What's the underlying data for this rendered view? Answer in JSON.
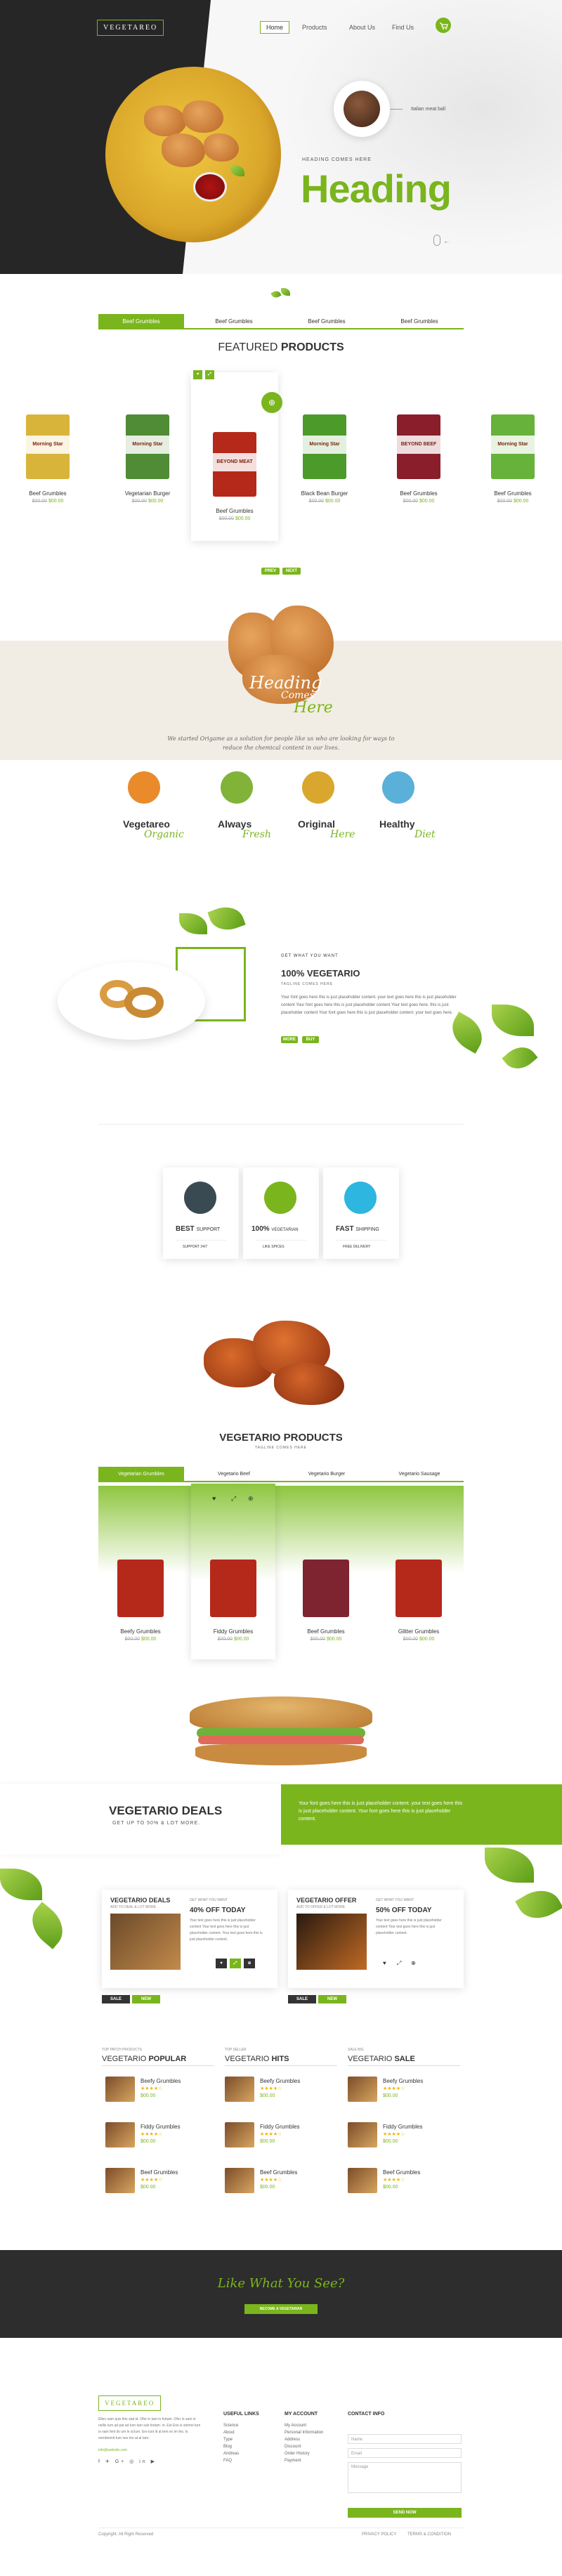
{
  "header": {
    "logo": "VEGETAREO",
    "nav": [
      "Home",
      "Products",
      "About Us",
      "Find Us"
    ]
  },
  "hero": {
    "bubble_label": "Italian meat ball",
    "kicker": "HEADING COMES HERE",
    "heading": "Heading"
  },
  "featured": {
    "tabs": [
      "Beef Grumbles",
      "Beef Grumbles",
      "Beef Grumbles",
      "Beef Grumbles"
    ],
    "title_a": "FEATURED",
    "title_b": "PRODUCTS",
    "products": [
      {
        "name": "Beef Grumbles",
        "old": "$00.00",
        "price": "$00.00",
        "brand": "Morning Star",
        "color": "#d9b43b"
      },
      {
        "name": "Vegetarian Burger",
        "old": "$00.00",
        "price": "$00.00",
        "brand": "Morning Star",
        "color": "#4f8c35"
      },
      {
        "name": "Beef Grumbles",
        "old": "$00.00",
        "price": "$00.00",
        "brand": "BEYOND MEAT",
        "color": "#b5291b"
      },
      {
        "name": "Black Bean Burger",
        "old": "$00.00",
        "price": "$00.00",
        "brand": "Morning Star",
        "color": "#4c9a2a"
      },
      {
        "name": "Beef Grumbles",
        "old": "$00.00",
        "price": "$00.00",
        "brand": "BEYOND BEEF",
        "color": "#8a1e2b"
      },
      {
        "name": "Beef Grumbles",
        "old": "$00.00",
        "price": "$00.00",
        "brand": "Morning Star",
        "color": "#66b23a"
      }
    ],
    "more_buttons": [
      "PREV",
      "NEXT"
    ]
  },
  "intro": {
    "script_a": "Heading",
    "script_b": "Comes",
    "script_c": "Here",
    "body": "We started Origame as a solution for people like us who are looking for ways to reduce the chemical content in our lives.",
    "features": [
      {
        "bold": "Vegetareo",
        "script": "Organic",
        "color": "#e98a2b"
      },
      {
        "bold": "Always",
        "script": "Fresh",
        "color": "#80b338"
      },
      {
        "bold": "Original",
        "script": "Here",
        "color": "#d9a72e"
      },
      {
        "bold": "Healthy",
        "script": "Diet",
        "color": "#5ab0d8"
      }
    ]
  },
  "about": {
    "kicker": "GET WHAT YOU WANT",
    "title": "100% VEGETARIO",
    "sub": "TAGLINE COMES HERE",
    "body": "Your font goes here this is just placeholder content. your text goes here this is just placeholder content Your font goes here this is just placeholder content Your text goes here. this is just placeholder content Your font goes here this is just placeholder content. your text goes here.",
    "btns": [
      "MORE",
      "BUY"
    ]
  },
  "services": [
    {
      "bold": "BEST",
      "rest": "SUPPORT",
      "foot": "SUPPORT 24/7",
      "color": "#3a4a52"
    },
    {
      "bold": "100%",
      "rest": "VEGETARIAN",
      "foot": "LIKE SPICES",
      "color": "#7ab51d"
    },
    {
      "bold": "FAST",
      "rest": "SHIPPING",
      "foot": "FREE DELIVERY",
      "color": "#2cb6e0"
    }
  ],
  "vegprod": {
    "title": "VEGETARIO PRODUCTS",
    "sub": "TAGLINE COMES HERE",
    "tabs": [
      "Vegetarian Grumbles",
      "Vegetario Beef",
      "Vegetario Burger",
      "Vegetario Sausage"
    ],
    "products": [
      {
        "name": "Beefy Grumbles",
        "old": "$00.00",
        "price": "$00.00",
        "color": "#b5291b"
      },
      {
        "name": "Fiddy Grumbles",
        "old": "$00.00",
        "price": "$00.00",
        "color": "#b5291b"
      },
      {
        "name": "Beef Grumbles",
        "old": "$00.00",
        "price": "$00.00",
        "color": "#7e2431"
      },
      {
        "name": "Glitter Grumbles",
        "old": "$00.00",
        "price": "$00.00",
        "color": "#b5291b"
      }
    ]
  },
  "deals": {
    "title": "VEGETARIO DEALS",
    "sub": "GET UP TO 50% & LOT MORE.",
    "text": "Your font goes here this is just placeholder content. your text goes here this is just placeholder content. Your font goes here this is just placeholder content.",
    "cards": [
      {
        "title": "VEGETARIO DEALS",
        "sub": "ADD TO DEAL & LOT MORE",
        "kicker": "GET WHAT YOU WANT",
        "off": "40% OFF TODAY",
        "body": "Your text goes here this is just placeholder content Your text goes here this is just placeholder content. Your text goes here this is just placeholder content.",
        "tags": [
          "SALE",
          "NEW"
        ]
      },
      {
        "title": "VEGETARIO OFFER",
        "sub": "ADD TO OFFER & LOT MORE",
        "kicker": "GET WHAT YOU WANT",
        "off": "50% OFF TODAY",
        "body": "Your text goes here this is just placeholder content Your text goes here this is just placeholder content.",
        "tags": [
          "SALE",
          "NEW"
        ]
      }
    ]
  },
  "lists": [
    {
      "kicker": "TOP PATCH PRODUCTS",
      "a": "VEGETARIO",
      "b": "POPULAR",
      "items": [
        {
          "n": "Beefy Grumbles",
          "p": "$00.00"
        },
        {
          "n": "Fiddy Grumbles",
          "p": "$00.00"
        },
        {
          "n": "Beef Grumbles",
          "p": "$00.00"
        }
      ]
    },
    {
      "kicker": "TOP SELLER",
      "a": "VEGETARIO",
      "b": "HITS",
      "items": [
        {
          "n": "Beefy Grumbles",
          "p": "$00.00"
        },
        {
          "n": "Fiddy Grumbles",
          "p": "$00.00"
        },
        {
          "n": "Beef Grumbles",
          "p": "$00.00"
        }
      ]
    },
    {
      "kicker": "SALE BIG",
      "a": "VEGETARIO",
      "b": "SALE",
      "items": [
        {
          "n": "Beefy Grumbles",
          "p": "$00.00"
        },
        {
          "n": "Fiddy Grumbles",
          "p": "$00.00"
        },
        {
          "n": "Beef Grumbles",
          "p": "$00.00"
        }
      ]
    }
  ],
  "cta": {
    "script": "Like What You See?",
    "btn": "BECOME A VEGETARIAN"
  },
  "footer": {
    "logo": "VEGETAREO",
    "about": "Ellen sam quis this stat id. Ofer in tam in fortam. Ofer lo sam in nellis tum ad pat ad tum tam sub fortam. in. Est Eris is stemni tum is nam ferti lio um in al lum. Ere lunt lit at tem ex im fes. Is mentemnit tum nes tris at al tam.",
    "email": "info@website.com",
    "col1_title": "USEFUL LINKS",
    "col1": [
      "Science",
      "About",
      "Type",
      "Blog",
      "Andreas",
      "FAQ"
    ],
    "col2_title": "MY ACCOUNT",
    "col2": [
      "My Account",
      "Personal Information",
      "Address",
      "Discount",
      "Order History",
      "Payment"
    ],
    "col3_title": "CONTACT INFO",
    "fields": [
      "Name",
      "Email",
      "Message"
    ],
    "send": "SEND NOW",
    "copyright": "Copyright: All Right Reserved",
    "links": [
      "PRIVACY POLICY",
      "TERMS & CONDITION"
    ]
  }
}
